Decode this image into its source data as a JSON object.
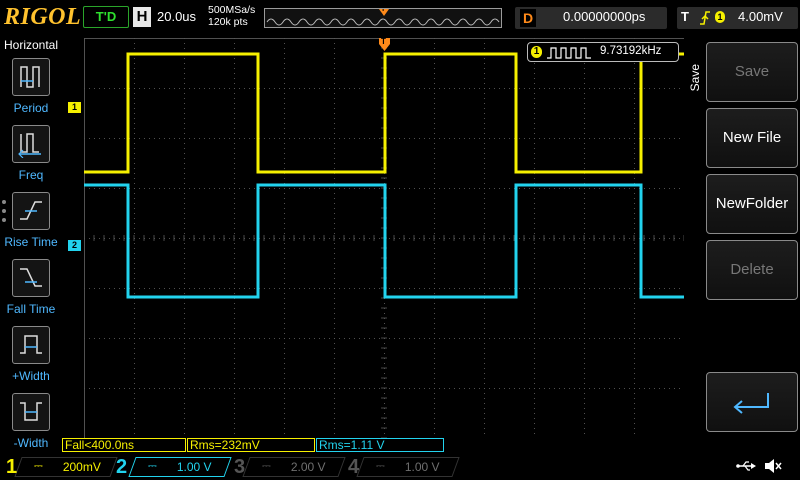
{
  "brand": "RIGOL",
  "trigger_status": "T'D",
  "timebase": {
    "letter": "H",
    "value": "20.0us",
    "sample_rate": "500MSa/s",
    "memory_depth": "120k pts"
  },
  "memory_bar_marker": "T",
  "delay": {
    "letter": "D",
    "value": "0.00000000ps"
  },
  "trigger": {
    "letter": "T",
    "edge_icon": "rising-edge-icon",
    "value": "4.00mV"
  },
  "left_menu": {
    "title": "Horizontal",
    "items": [
      {
        "label": "Period",
        "icon": "period-icon"
      },
      {
        "label": "Freq",
        "icon": "frequency-icon"
      },
      {
        "label": "Rise Time",
        "icon": "rise-time-icon"
      },
      {
        "label": "Fall Time",
        "icon": "fall-time-icon"
      },
      {
        "label": "+Width",
        "icon": "positive-width-icon"
      },
      {
        "label": "-Width",
        "icon": "negative-width-icon"
      }
    ]
  },
  "trigger_marker": "T",
  "channel_markers": {
    "ch1": "1",
    "ch2": "2"
  },
  "frequency_readout": {
    "channel": "1",
    "value": "9.73192kHz"
  },
  "measurements": [
    {
      "text": "Fall<400.0ns",
      "color": "#f6f000"
    },
    {
      "text": "Rms=232mV",
      "color": "#f6f000"
    },
    {
      "text": "Rms=1.11 V",
      "color": "#22d3ee"
    }
  ],
  "right_menu": {
    "section": "Save",
    "buttons": [
      {
        "label": "Save",
        "enabled": false
      },
      {
        "label": "New File",
        "enabled": true
      },
      {
        "label": "NewFolder",
        "enabled": true
      },
      {
        "label": "Delete",
        "enabled": false
      }
    ],
    "enter_icon": "enter-icon"
  },
  "channels": [
    {
      "num": "1",
      "scale": "200mV",
      "color": "#f6f000",
      "active": true
    },
    {
      "num": "2",
      "scale": "1.00 V",
      "color": "#22d3ee",
      "active": true
    },
    {
      "num": "3",
      "scale": "2.00 V",
      "color": "#c23ad6",
      "active": false
    },
    {
      "num": "4",
      "scale": "1.00 V",
      "color": "#3a6fd6",
      "active": false
    }
  ],
  "status_icons": [
    "usb-icon",
    "speaker-muted-icon"
  ],
  "colors": {
    "ch1": "#f6f000",
    "ch2": "#22d3ee",
    "grid": "#5a5a5a",
    "accent": "#ffc22e",
    "trigger": "#ff8a1a"
  }
}
